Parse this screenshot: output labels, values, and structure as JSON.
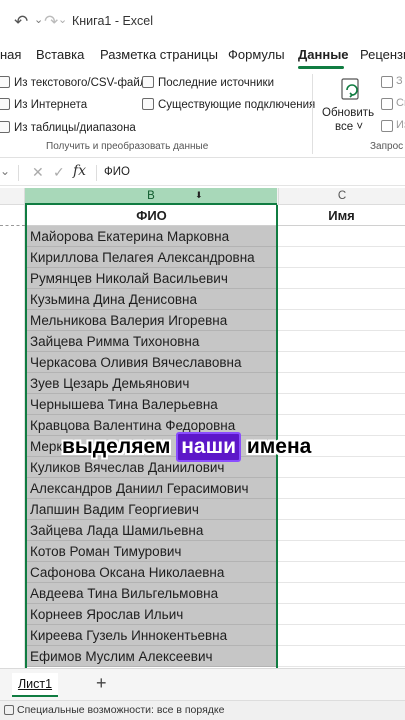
{
  "titlebar": {
    "title": "Книга1  -  Excel"
  },
  "tabs": [
    {
      "label": "ная"
    },
    {
      "label": "Вставка"
    },
    {
      "label": "Разметка страницы"
    },
    {
      "label": "Формулы"
    },
    {
      "label": "Данные"
    },
    {
      "label": "Рецензи"
    }
  ],
  "ribbon": {
    "get_data": {
      "from_text_csv": "Из текстового/CSV-файла",
      "from_web": "Из Интернета",
      "from_table": "Из таблицы/диапазона",
      "recent_sources": "Последние источники",
      "existing_connections": "Существующие подключения",
      "group_label": "Получить и преобразовать данные"
    },
    "refresh": {
      "line1": "Обновить",
      "line2": "все ˅"
    },
    "queries_group_label": "Запрос",
    "right_clipped": [
      "З",
      "Св",
      "Из"
    ]
  },
  "formula_bar": {
    "value": "ФИО"
  },
  "columns": {
    "B": "B",
    "C": "C"
  },
  "sheet": {
    "header_b": "ФИО",
    "header_c": "Имя",
    "names": [
      "Майорова Екатерина Марковна",
      "Кириллова Пелагея Александровна",
      "Румянцев Николай Васильевич",
      "Кузьмина Дина Денисовна",
      "Мельникова Валерия Игоревна",
      "Зайцева Римма Тихоновна",
      "Черкасова Оливия Вячеславовна",
      "Зуев Цезарь Демьянович",
      "Чернышева Тина Валерьевна",
      "Кравцова Валентина Федоровна",
      "Мерк",
      "Куликов Вячеслав Даниилович",
      "Александров Даниил Герасимович",
      "Лапшин Вадим Георгиевич",
      "Зайцева Лада Шамильевна",
      "Котов Роман Тимурович",
      "Сафонова Оксана Николаевна",
      "Авдеева Тина Вильгельмовна",
      "Корнеев Ярослав Ильич",
      "Киреева Гузель Иннокентьевна",
      "Ефимов Муслим Алексеевич"
    ]
  },
  "caption": {
    "before": "выделяем ",
    "highlight": "наши",
    "after": " имена"
  },
  "sheet_tabs": [
    {
      "label": "Лист1"
    }
  ],
  "statusbar": {
    "text": "Специальные возможности: все в порядке"
  },
  "colors": {
    "accent": "#107c41",
    "selection": "#c6c6c6",
    "caption_highlight": "#5d17c9"
  }
}
